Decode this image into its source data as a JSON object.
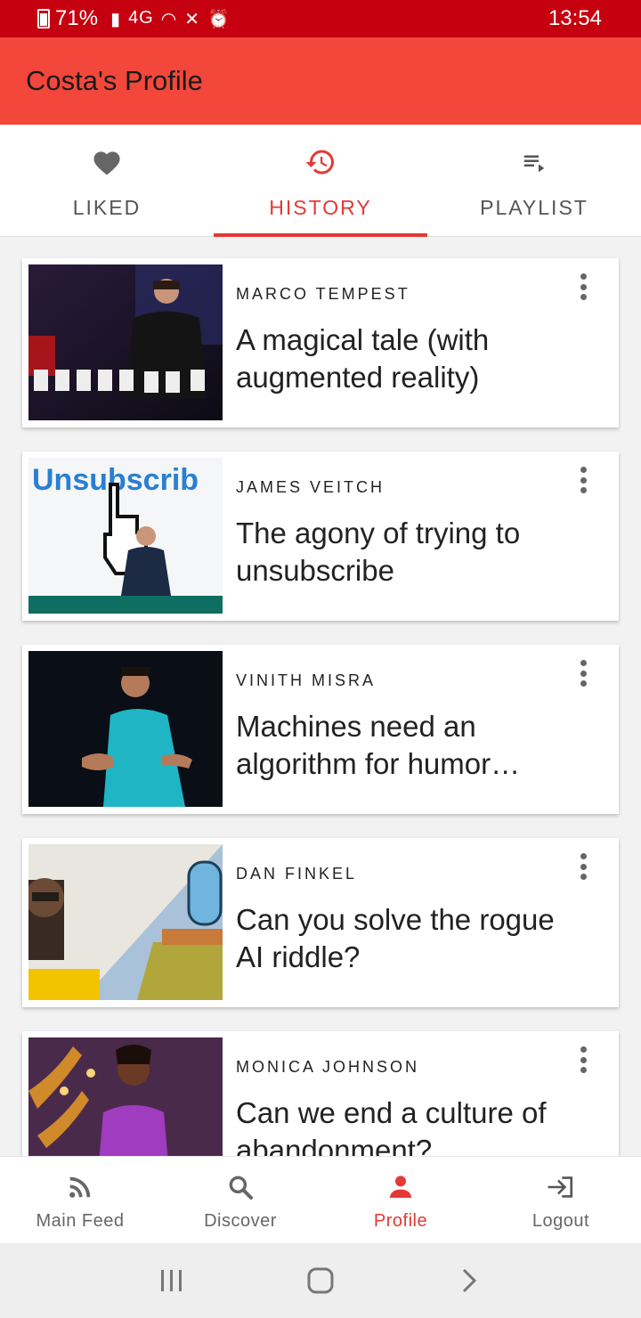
{
  "status_bar": {
    "battery": "71%",
    "network": "4G",
    "time": "13:54",
    "bg_color": "#c5000f"
  },
  "app_bar": {
    "title": "Costa's Profile",
    "bg_color": "#f3473b"
  },
  "tabs": [
    {
      "label": "LIKED",
      "icon": "heart-icon",
      "active": false
    },
    {
      "label": "HISTORY",
      "icon": "history-icon",
      "active": true
    },
    {
      "label": "PLAYLIST",
      "icon": "playlist-icon",
      "active": false
    }
  ],
  "talks": [
    {
      "speaker": "MARCO TEMPEST",
      "title": "A magical tale (with augmented reality)",
      "thumb_word": "ECEPTION"
    },
    {
      "speaker": "JAMES VEITCH",
      "title": "The agony of trying to unsubscribe",
      "thumb_word": "Unsubscrib"
    },
    {
      "speaker": "VINITH MISRA",
      "title": "Machines need an algorithm for humor…"
    },
    {
      "speaker": "DAN FINKEL",
      "title": "Can you solve the rogue AI riddle?"
    },
    {
      "speaker": "MONICA JOHNSON",
      "title": "Can we end a culture of abandonment?"
    }
  ],
  "bottom_nav": [
    {
      "label": "Main Feed",
      "icon": "rss-icon",
      "active": false
    },
    {
      "label": "Discover",
      "icon": "search-icon",
      "active": false
    },
    {
      "label": "Profile",
      "icon": "person-icon",
      "active": true
    },
    {
      "label": "Logout",
      "icon": "logout-icon",
      "active": false
    }
  ],
  "colors": {
    "accent": "#e53935",
    "inactive": "#666666"
  }
}
